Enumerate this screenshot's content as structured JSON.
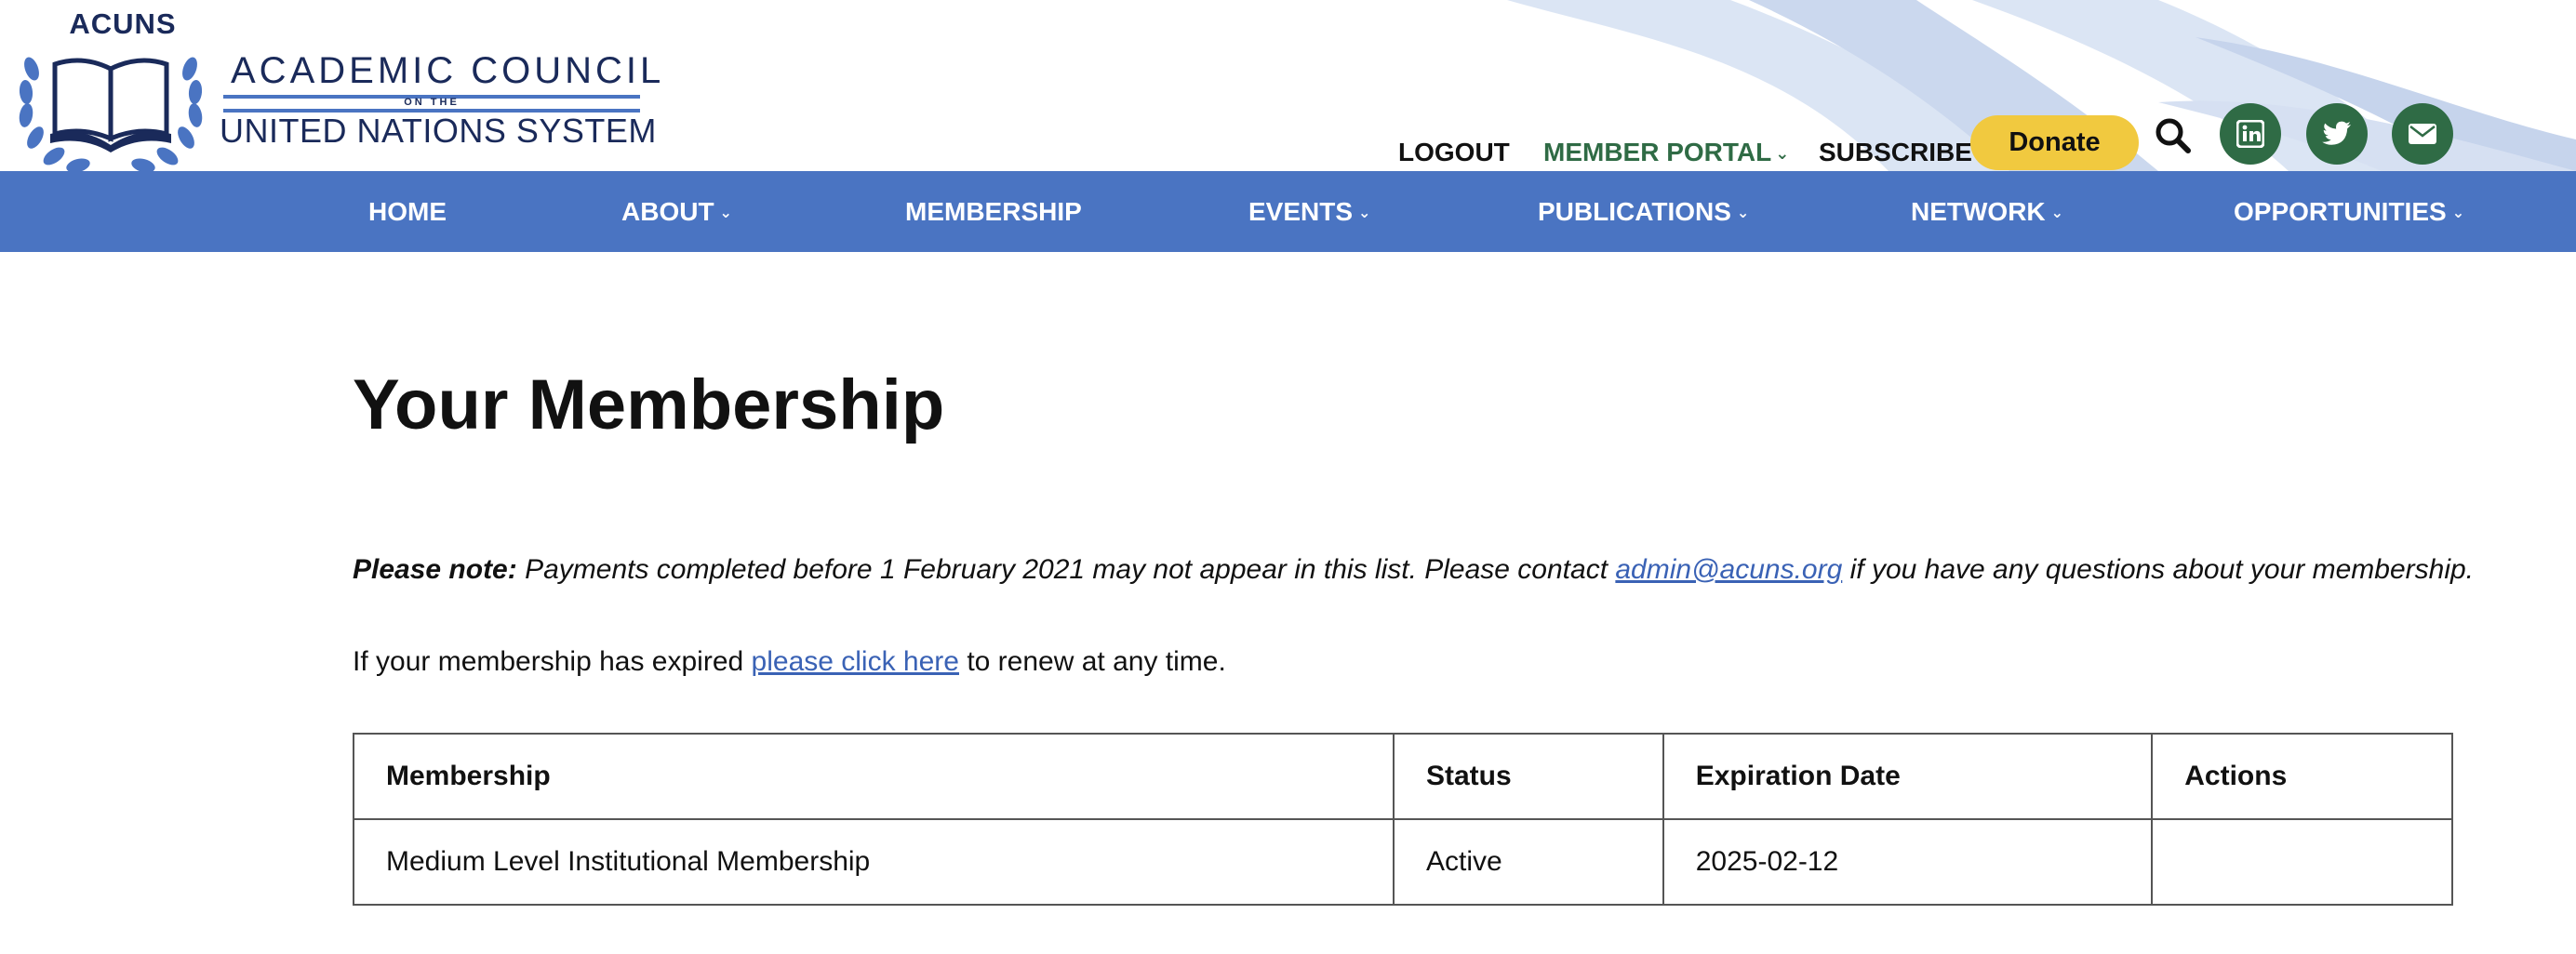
{
  "header": {
    "logo": {
      "acronym": "ACUNS",
      "line1": "ACADEMIC COUNCIL",
      "on_the": "ON THE",
      "line2": "UNITED NATIONS SYSTEM"
    },
    "utility_links": {
      "logout": "LOGOUT",
      "member_portal": "MEMBER PORTAL",
      "subscribe": "SUBSCRIBE"
    },
    "donate_label": "Donate",
    "icons": [
      "search-icon",
      "linkedin-icon",
      "twitter-icon",
      "mail-icon"
    ]
  },
  "nav": {
    "items": [
      {
        "label": "HOME",
        "has_dropdown": false
      },
      {
        "label": "ABOUT",
        "has_dropdown": true
      },
      {
        "label": "MEMBERSHIP",
        "has_dropdown": false
      },
      {
        "label": "EVENTS",
        "has_dropdown": true
      },
      {
        "label": "PUBLICATIONS",
        "has_dropdown": true
      },
      {
        "label": "NETWORK",
        "has_dropdown": true
      },
      {
        "label": "OPPORTUNITIES",
        "has_dropdown": true
      }
    ]
  },
  "main": {
    "title": "Your Membership",
    "note": {
      "label": "Please note:",
      "text_before": " Payments completed before 1 February 2021 may not appear in this list. Please contact ",
      "email": "admin@acuns.org",
      "text_after": " if you have any questions about your membership."
    },
    "renew": {
      "text_before": "If your membership has expired ",
      "link": "please click here",
      "text_after": " to renew at any time."
    },
    "table": {
      "headers": [
        "Membership",
        "Status",
        "Expiration Date",
        "Actions"
      ],
      "rows": [
        [
          "Medium Level Institutional Membership",
          "Active",
          "2025-02-12",
          ""
        ]
      ]
    }
  },
  "colors": {
    "nav_bg": "#4a74c2",
    "brand_green": "#2f6b45",
    "donate_yellow": "#f1c93f",
    "link_blue": "#3a62b5",
    "logo_navy": "#1a2a5a"
  }
}
